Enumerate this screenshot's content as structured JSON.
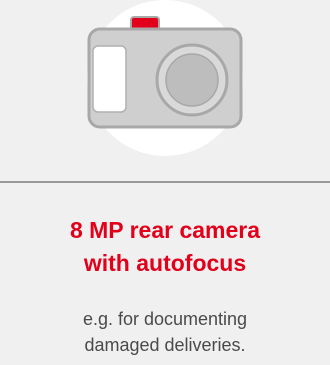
{
  "feature": {
    "icon": "camera-icon",
    "title_line1": "8 MP rear camera",
    "title_line2": "with autofocus",
    "desc_line1": "e.g. for documenting",
    "desc_line2": "damaged deliveries."
  },
  "colors": {
    "accent": "#e2001a",
    "background": "#f0f0f0",
    "text": "#4a4a4a",
    "divider": "#9a9a9a"
  }
}
